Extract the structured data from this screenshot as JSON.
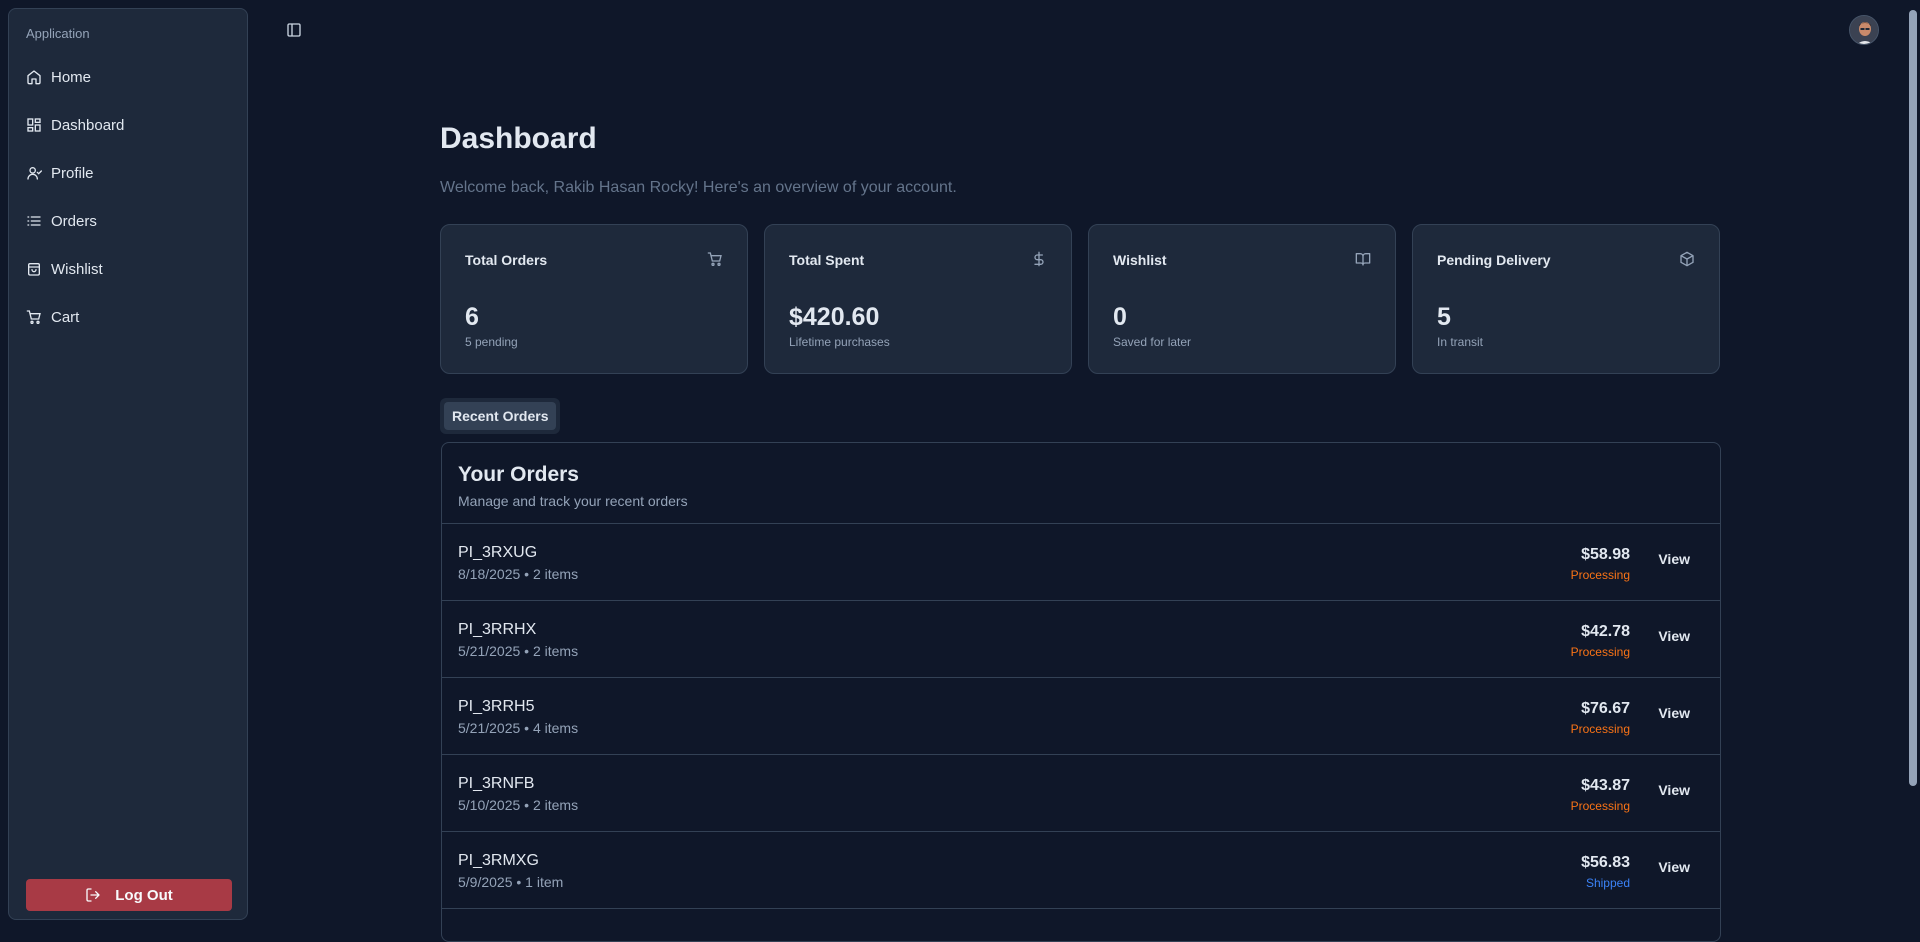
{
  "sidebar": {
    "group_label": "Application",
    "items": [
      {
        "label": "Home",
        "icon": "home-icon"
      },
      {
        "label": "Dashboard",
        "icon": "grid-icon"
      },
      {
        "label": "Profile",
        "icon": "user-icon"
      },
      {
        "label": "Orders",
        "icon": "list-icon"
      },
      {
        "label": "Wishlist",
        "icon": "bag-icon"
      },
      {
        "label": "Cart",
        "icon": "cart-icon"
      }
    ],
    "logout_label": "Log Out"
  },
  "page": {
    "title": "Dashboard",
    "subtitle": "Welcome back, Rakib Hasan Rocky! Here's an overview of your account."
  },
  "stats": [
    {
      "title": "Total Orders",
      "value": "6",
      "sub": "5 pending",
      "icon": "cart-icon"
    },
    {
      "title": "Total Spent",
      "value": "$420.60",
      "sub": "Lifetime purchases",
      "icon": "dollar-icon"
    },
    {
      "title": "Wishlist",
      "value": "0",
      "sub": "Saved for later",
      "icon": "book-icon"
    },
    {
      "title": "Pending Delivery",
      "value": "5",
      "sub": "In transit",
      "icon": "package-icon"
    }
  ],
  "tabs": {
    "recent_orders": "Recent Orders"
  },
  "orders": {
    "title": "Your Orders",
    "subtitle": "Manage and track your recent orders",
    "view_label": "View",
    "rows": [
      {
        "id": "PI_3RXUG",
        "meta": "8/18/2025 • 2 items",
        "amount": "$58.98",
        "status": "Processing"
      },
      {
        "id": "PI_3RRHX",
        "meta": "5/21/2025 • 2 items",
        "amount": "$42.78",
        "status": "Processing"
      },
      {
        "id": "PI_3RRH5",
        "meta": "5/21/2025 • 4 items",
        "amount": "$76.67",
        "status": "Processing"
      },
      {
        "id": "PI_3RNFB",
        "meta": "5/10/2025 • 2 items",
        "amount": "$43.87",
        "status": "Processing"
      },
      {
        "id": "PI_3RMXG",
        "meta": "5/9/2025 • 1 item",
        "amount": "$56.83",
        "status": "Shipped"
      }
    ]
  },
  "colors": {
    "processing": "#f97316",
    "shipped": "#3b82f6",
    "logout": "#a83a45"
  }
}
